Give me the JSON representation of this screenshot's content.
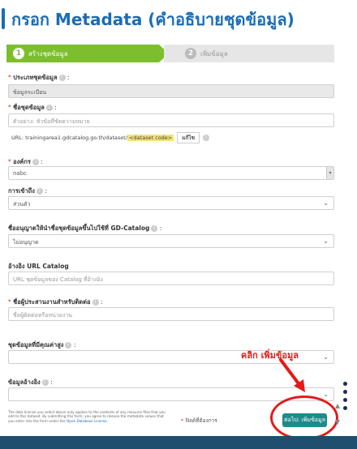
{
  "title": "กรอก Metadata (คำอธิบายชุดข้อมูล)",
  "stepper": {
    "step1": {
      "number": "1",
      "label": "สร้างชุดข้อมูล"
    },
    "step2": {
      "number": "2",
      "label": "เพิ่มข้อมูล"
    }
  },
  "form": {
    "dataset_type": {
      "label": "ประเภทชุดข้อมูล",
      "value": "ข้อมูลระเบียน"
    },
    "dataset_name": {
      "label": "ชื่อชุดข้อมูล",
      "placeholder": "ตัวอย่าง: หัวข้อที่ชัดความหมาย"
    },
    "url": {
      "prefix": "URL: trainingarea1.gdcatalog.go.th/dataset/",
      "code": "<dataset code>",
      "edit_label": "แก้ไข"
    },
    "organization": {
      "label": "องค์กร",
      "value": "nabc"
    },
    "visibility": {
      "label": "การเข้าถึง",
      "value": "ส่วนตัว"
    },
    "gd_catalog": {
      "label": "ชื่ออนุญาตให้นำชื่อชุดข้อมูลขึ้นไปใช้ที่ GD-Catalog",
      "value": "ไม่อนุญาต"
    },
    "catalog_url": {
      "label": "อ้างอิง URL Catalog",
      "placeholder": "URL ชุดข้อมูลของ Catalog ที่อ้างอิง"
    },
    "responsible": {
      "label": "ชื่อผู้ประสานงานสำหรับติดต่อ",
      "placeholder": "ชื่อผู้ติดต่อหรือหน่วยงาน"
    },
    "quality": {
      "label": "ชุดข้อมูลที่มีคุณค่าสูง",
      "value": ""
    },
    "reference": {
      "label": "ข้อมูลอ้างอิง",
      "value": ""
    }
  },
  "annotation": {
    "text": "คลิก เพิ่มข้อมูล"
  },
  "footer": {
    "license_text": "The data license you select above only applies to the contents of any resource files that you add to this dataset. By submitting this form, you agree to release the metadata values that you enter into the form under the",
    "license_link": "Open Database License.",
    "required_note": "ฟิลด์ที่ต้องการ",
    "next_button": "ต่อไป: เพิ่มข้อมูล"
  },
  "colors": {
    "brand": "#1a6cb5",
    "step_active": "#7dbe2e",
    "button": "#1f8a8a",
    "annotation": "#e31b1b"
  }
}
